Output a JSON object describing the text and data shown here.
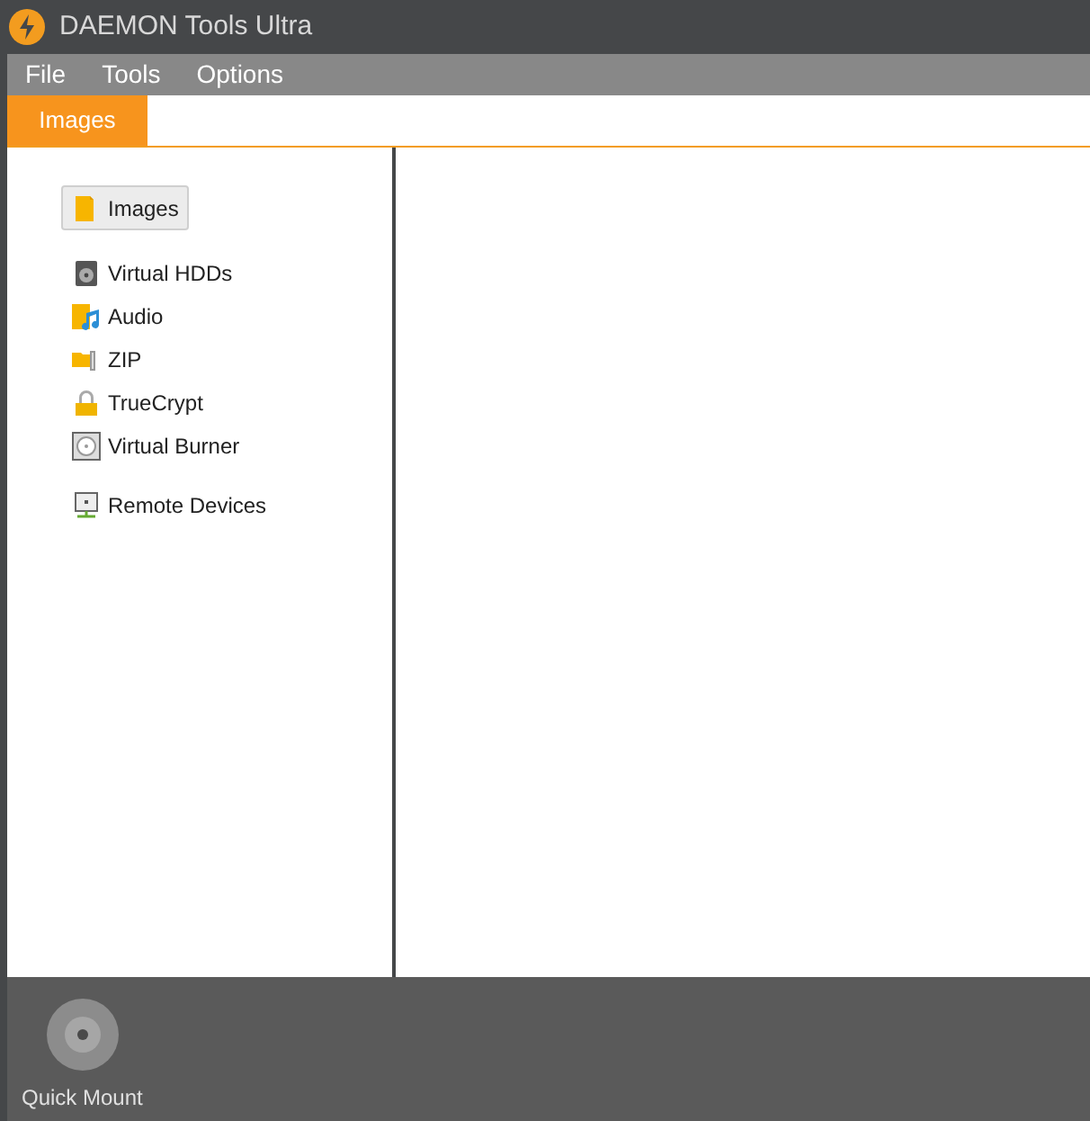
{
  "window": {
    "title": "DAEMON Tools Ultra"
  },
  "menu": [
    "File",
    "Tools",
    "Options"
  ],
  "tabs": [
    {
      "label": "Images",
      "selected": true
    }
  ],
  "sidebar": {
    "groups": [
      [
        {
          "label": "Images",
          "kind": "images",
          "selected": true
        }
      ],
      [
        {
          "label": "Virtual HDDs",
          "kind": "hdd",
          "selected": false
        },
        {
          "label": "Audio",
          "kind": "audio",
          "selected": false
        },
        {
          "label": "ZIP",
          "kind": "zip",
          "selected": false
        },
        {
          "label": "TrueCrypt",
          "kind": "lock",
          "selected": false
        },
        {
          "label": "Virtual Burner",
          "kind": "burner",
          "selected": false
        }
      ],
      [
        {
          "label": "Remote Devices",
          "kind": "remote",
          "selected": false
        }
      ]
    ]
  },
  "bottom_bar": {
    "items": [
      {
        "label": "Quick Mount"
      }
    ]
  }
}
